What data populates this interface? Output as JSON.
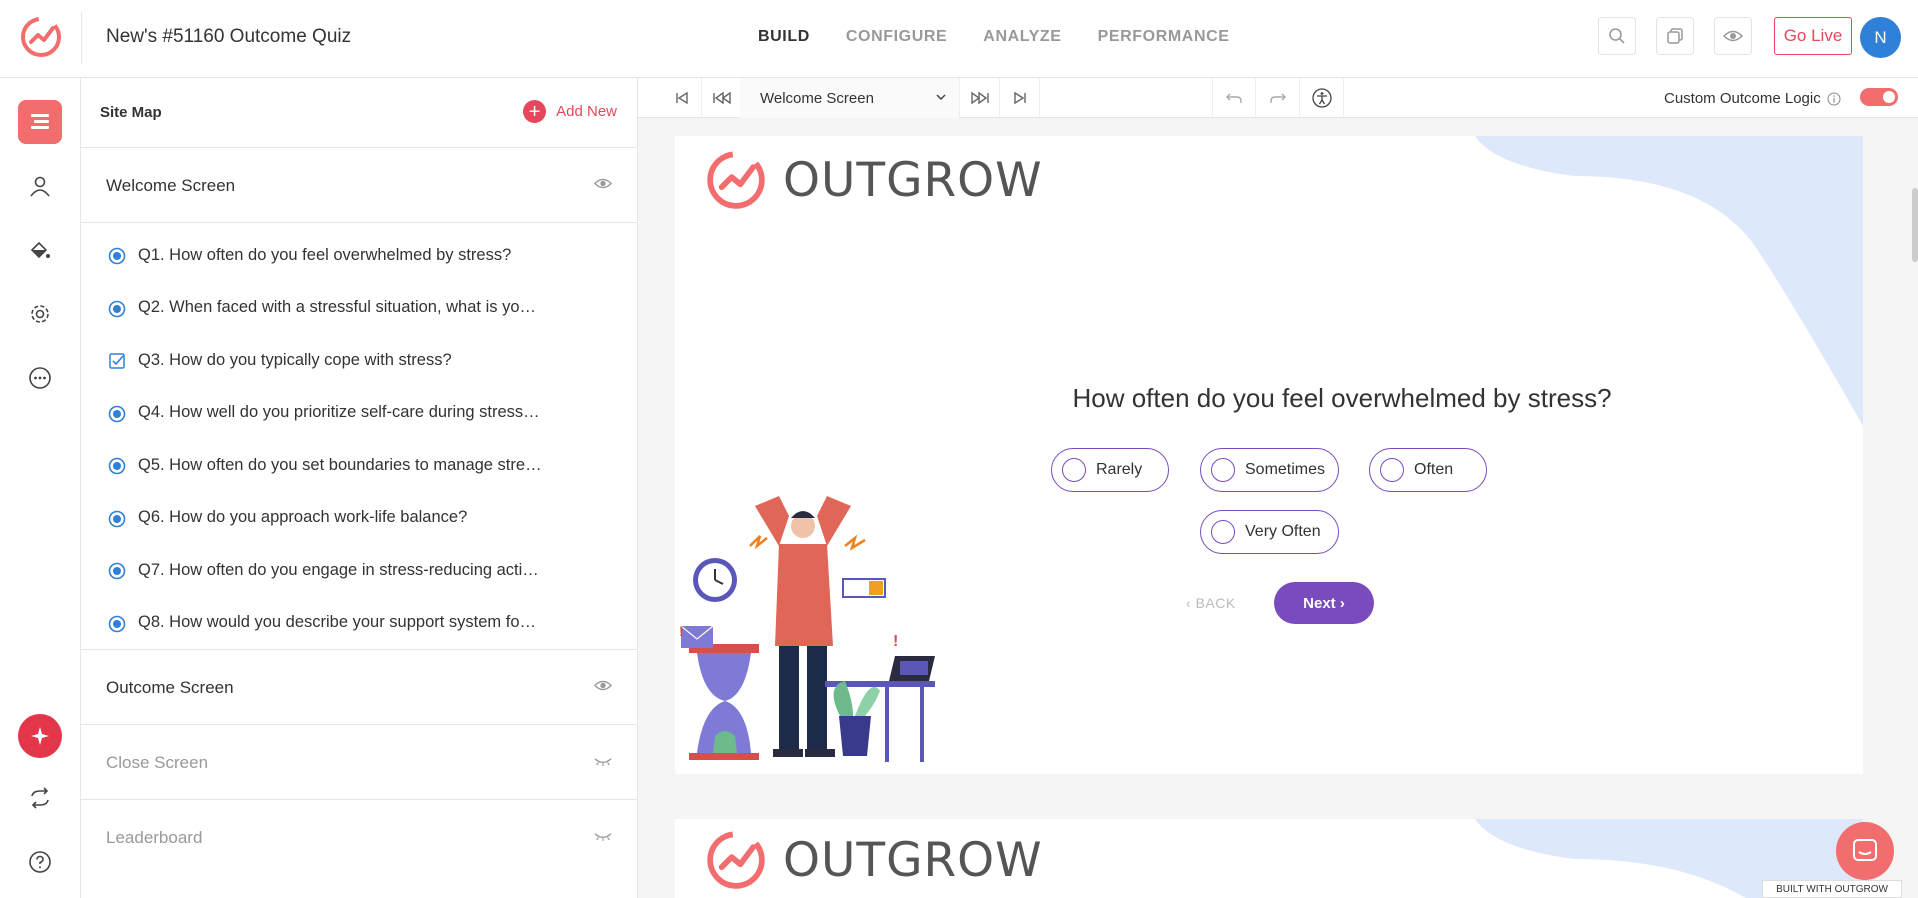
{
  "header": {
    "title": "New's #51160 Outcome Quiz",
    "tabs": [
      {
        "label": "BUILD",
        "active": true
      },
      {
        "label": "CONFIGURE",
        "active": false
      },
      {
        "label": "ANALYZE",
        "active": false
      },
      {
        "label": "PERFORMANCE",
        "active": false
      }
    ],
    "go_live_label": "Go Live",
    "avatar_initial": "N"
  },
  "sidebar": {
    "title": "Site Map",
    "add_new_label": "Add New",
    "welcome_screen": "Welcome Screen",
    "questions": [
      {
        "label": "Q1. How often do you feel overwhelmed by stress?",
        "type": "radio"
      },
      {
        "label": "Q2. When faced with a stressful situation, what is yo…",
        "type": "radio"
      },
      {
        "label": "Q3. How do you typically cope with stress?",
        "type": "checkbox"
      },
      {
        "label": "Q4. How well do you prioritize self-care during stress…",
        "type": "radio"
      },
      {
        "label": "Q5. How often do you set boundaries to manage stre…",
        "type": "radio"
      },
      {
        "label": "Q6. How do you approach work-life balance?",
        "type": "radio"
      },
      {
        "label": "Q7. How often do you engage in stress-reducing acti…",
        "type": "radio"
      },
      {
        "label": "Q8. How would you describe your support system fo…",
        "type": "radio"
      }
    ],
    "outcome_screen": "Outcome Screen",
    "close_screen": "Close Screen",
    "leaderboard": "Leaderboard"
  },
  "toolbar": {
    "screen_select": "Welcome Screen",
    "custom_outcome_label": "Custom Outcome Logic",
    "custom_outcome_on": true
  },
  "preview": {
    "brand_name": "OUTGROW",
    "question": "How often do you feel overwhelmed by stress?",
    "options": [
      "Rarely",
      "Sometimes",
      "Often",
      "Very Often"
    ],
    "back_label": "BACK",
    "next_label": "Next"
  },
  "footer": {
    "built_with": "BUILT WITH",
    "built_brand": "OUTGROW"
  },
  "colors": {
    "accent": "#e4495b",
    "purple": "#7a4bbd",
    "blue": "#2f80d8"
  }
}
